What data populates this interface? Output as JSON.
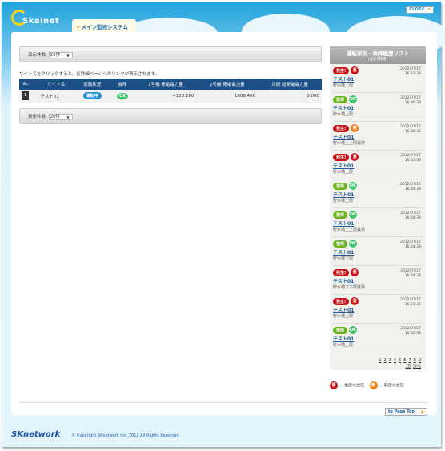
{
  "header": {
    "logo_text": "Skainet",
    "system_tab": "メイン監視システム",
    "close_label": "CLOSE"
  },
  "toolbar": {
    "count_label": "表示件数:",
    "count_value": "20件"
  },
  "note": "サイト名をクリックすると、各詳細ページへのリンクが表示されます。",
  "table": {
    "columns": [
      "No.",
      "サイト名",
      "運転状況",
      "故障",
      "1号機 発電電力量",
      "2号機 発電電力量",
      "共通 総発電電力量"
    ],
    "rows": [
      {
        "no": "1",
        "site": "テスト01",
        "status": "運転中",
        "fault": "OK",
        "gen1": "−120.280",
        "gen2": "1806.400",
        "total": "0.000"
      }
    ]
  },
  "history": {
    "title": "運転状況・故障履歴リスト",
    "subtitle": "(直近3日間)",
    "items": [
      {
        "type": "発生!",
        "sev": "重",
        "date": "2012/07/17",
        "time": "16:37:38",
        "site": "テスト01",
        "desc": "貯水槽上限"
      },
      {
        "type": "復帰",
        "sev": "OK",
        "date": "2012/07/17",
        "time": "16:36:38",
        "site": "テスト01",
        "desc": "貯水槽上限"
      },
      {
        "type": "発生!",
        "sev": "軽",
        "date": "2012/07/17",
        "time": "16:36:38",
        "site": "テスト01",
        "desc": "貯水槽上上限異常"
      },
      {
        "type": "発生!",
        "sev": "重",
        "date": "2012/07/17",
        "time": "16:35:38",
        "site": "テスト01",
        "desc": "貯水槽上限"
      },
      {
        "type": "復帰",
        "sev": "OK",
        "date": "2012/07/17",
        "time": "16:34:38",
        "site": "テスト01",
        "desc": "貯水槽上限"
      },
      {
        "type": "復帰",
        "sev": "OK",
        "date": "2012/07/17",
        "time": "16:34:38",
        "site": "テスト01",
        "desc": "貯水槽上上限異常"
      },
      {
        "type": "復帰",
        "sev": "OK",
        "date": "2012/07/17",
        "time": "16:34:38",
        "site": "テスト01",
        "desc": "貯水槽下限"
      },
      {
        "type": "発生!",
        "sev": "重",
        "date": "2012/07/17",
        "time": "16:34:38",
        "site": "テスト01",
        "desc": "貯水槽下下限異常"
      },
      {
        "type": "発生!",
        "sev": "重",
        "date": "2012/07/17",
        "time": "16:33:38",
        "site": "テスト01",
        "desc": "貯水槽上限"
      },
      {
        "type": "復帰",
        "sev": "OK",
        "date": "2012/07/17",
        "time": "16:32:38",
        "site": "テスト01",
        "desc": "貯水槽上限"
      }
    ],
    "pages": [
      "1",
      "2",
      "3",
      "4",
      "5",
      "6",
      "7",
      "8",
      "9",
      "10",
      "次へ"
    ]
  },
  "legend": {
    "major_icon": "重",
    "major": "… 重度な故障",
    "minor_icon": "軽",
    "minor": "… 軽度な故障"
  },
  "page_top": "to Page Top",
  "footer": {
    "logo": "SKnetwork",
    "copyright": "© Copyright SKnetwork Inc. 2012 All Rights Reserved."
  },
  "colors": {
    "header_blue": "#1b4f86",
    "occur_red": "#c81015",
    "recover_green": "#6ab31d",
    "minor_orange": "#f07a10",
    "ok_green": "#3fc46e"
  }
}
